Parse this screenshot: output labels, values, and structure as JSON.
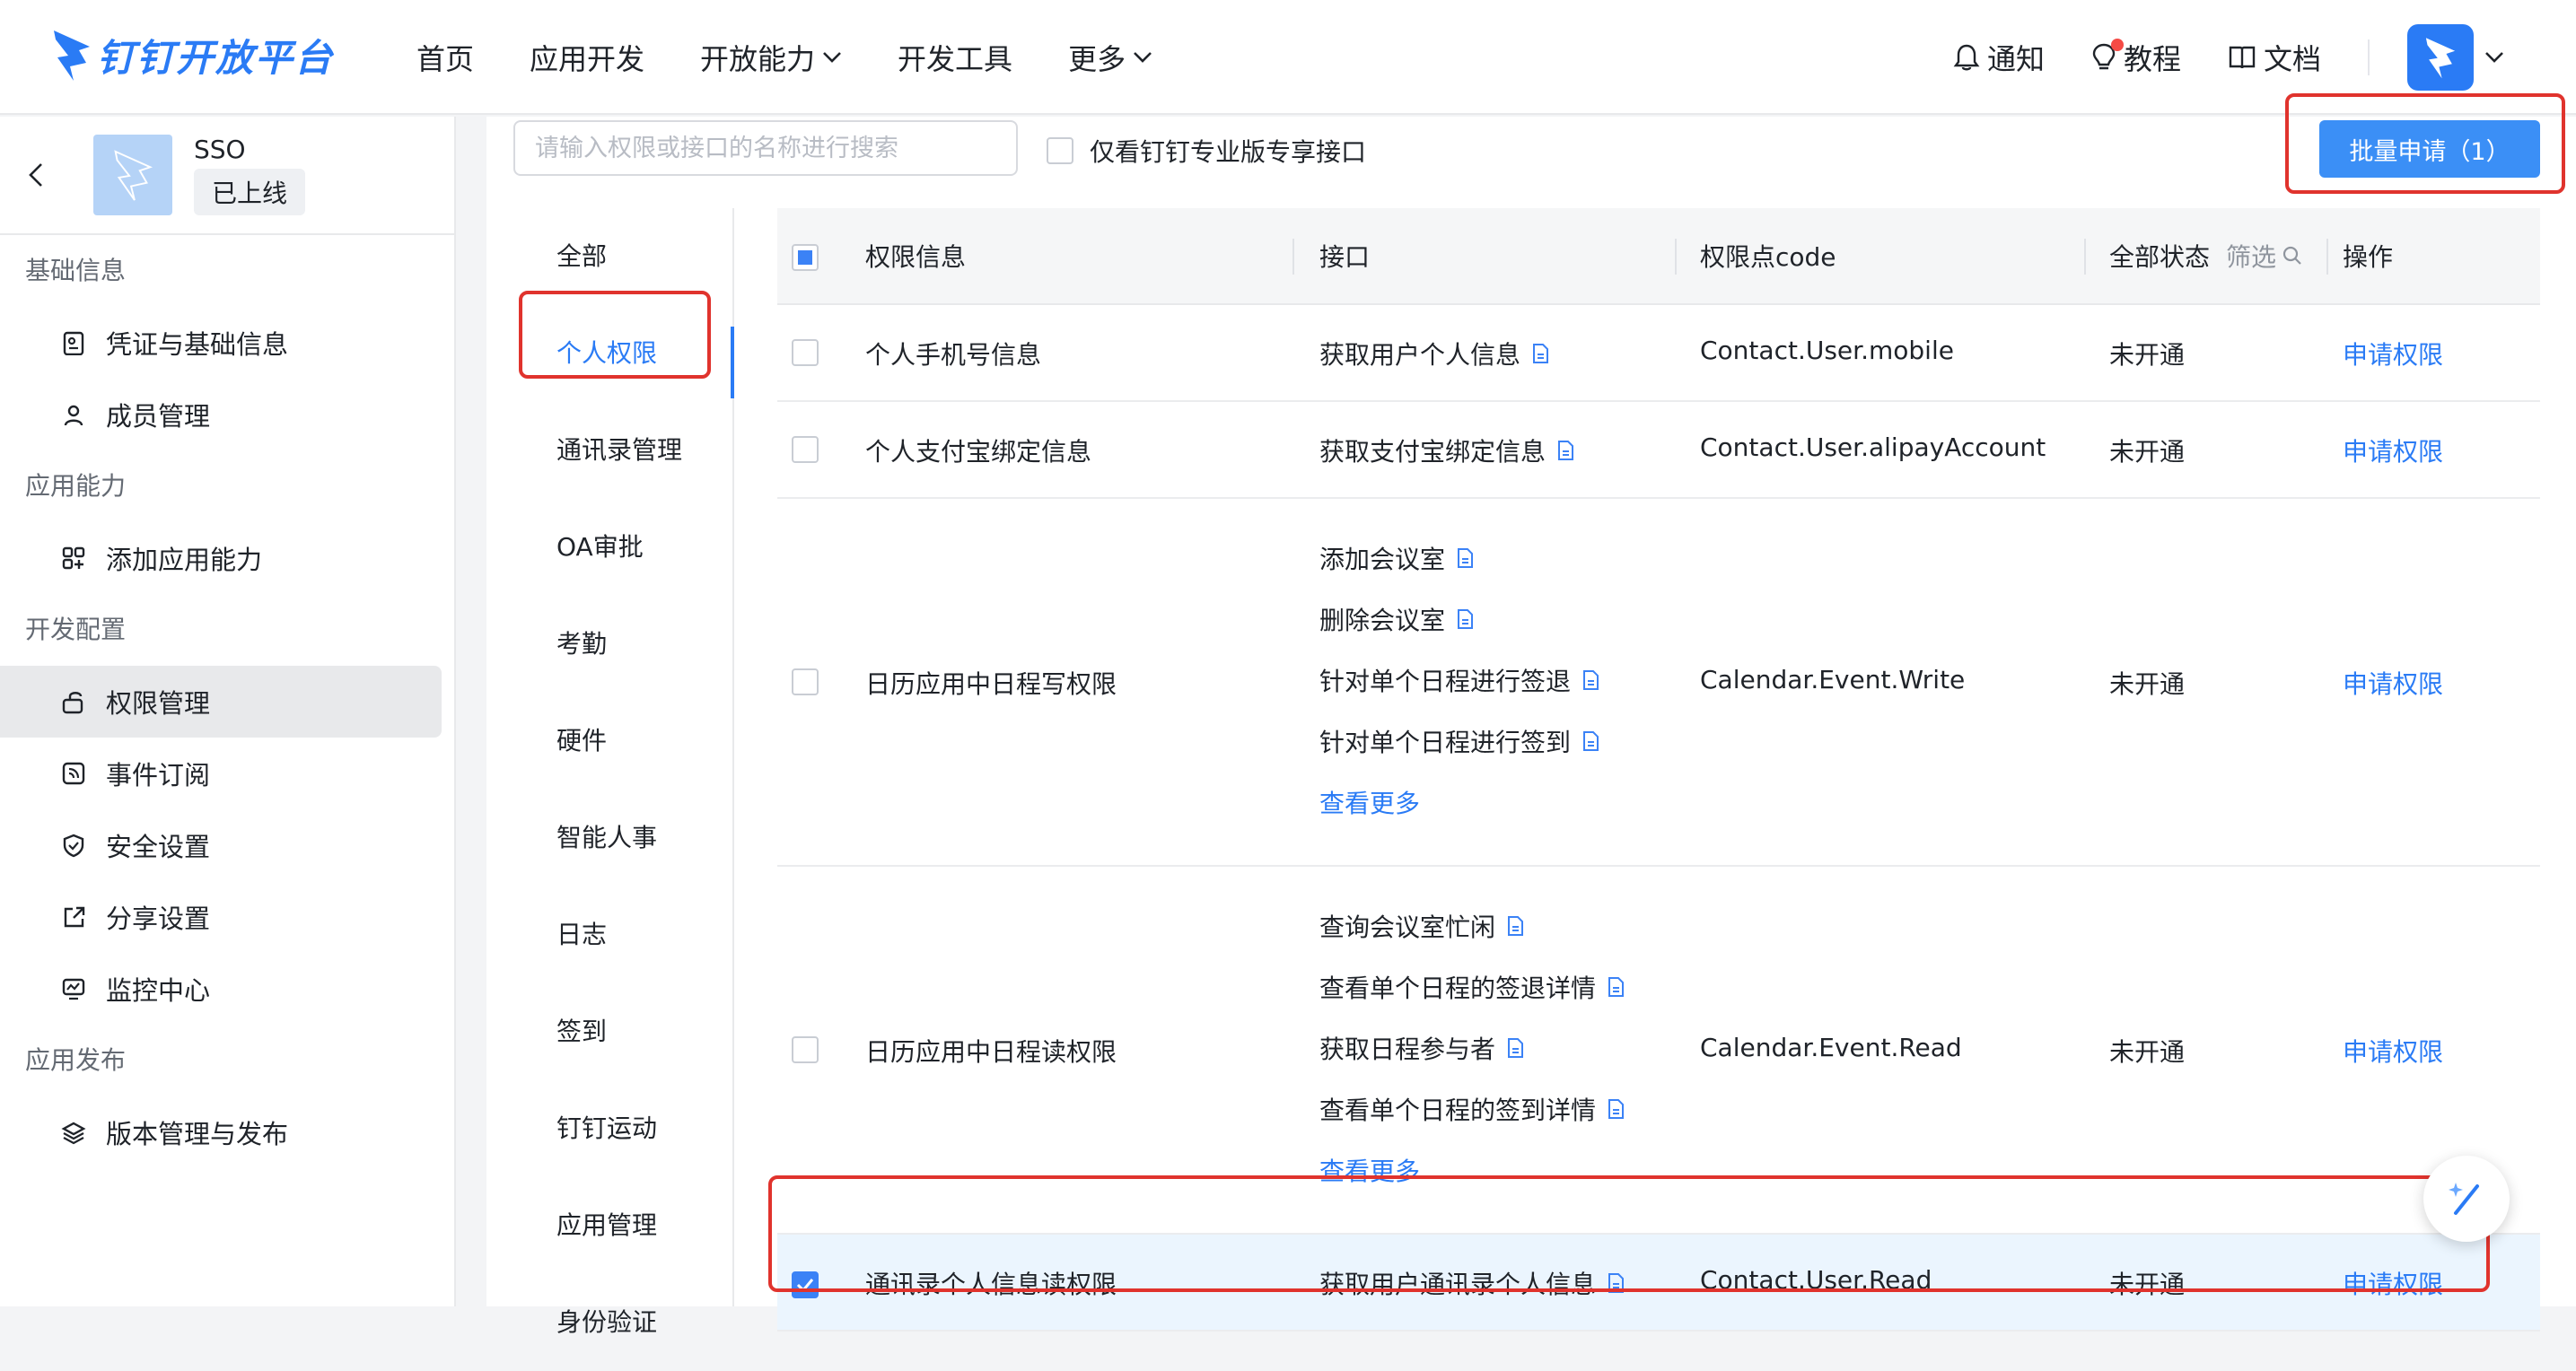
{
  "header": {
    "logo_text": "钉钉开放平台",
    "nav": [
      {
        "label": "首页",
        "dropdown": false
      },
      {
        "label": "应用开发",
        "dropdown": false
      },
      {
        "label": "开放能力",
        "dropdown": true
      },
      {
        "label": "开发工具",
        "dropdown": false
      },
      {
        "label": "更多",
        "dropdown": true
      }
    ],
    "notify_label": "通知",
    "tutorial_label": "教程",
    "docs_label": "文档"
  },
  "sidebar": {
    "app_name": "SSO",
    "app_status": "已上线",
    "groups": [
      {
        "title": "基础信息",
        "items": [
          {
            "label": "凭证与基础信息",
            "icon": "credential-icon"
          },
          {
            "label": "成员管理",
            "icon": "user-icon"
          }
        ]
      },
      {
        "title": "应用能力",
        "items": [
          {
            "label": "添加应用能力",
            "icon": "apps-add-icon"
          }
        ]
      },
      {
        "title": "开发配置",
        "items": [
          {
            "label": "权限管理",
            "icon": "lock-icon",
            "active": true
          },
          {
            "label": "事件订阅",
            "icon": "rss-icon"
          },
          {
            "label": "安全设置",
            "icon": "shield-icon"
          },
          {
            "label": "分享设置",
            "icon": "share-icon"
          },
          {
            "label": "监控中心",
            "icon": "monitor-icon"
          }
        ]
      },
      {
        "title": "应用发布",
        "items": [
          {
            "label": "版本管理与发布",
            "icon": "layers-icon"
          }
        ]
      }
    ]
  },
  "toolbar": {
    "search_placeholder": "请输入权限或接口的名称进行搜索",
    "pro_only_label": "仅看钉钉专业版专享接口",
    "batch_label": "批量申请（1）"
  },
  "categories": [
    "全部",
    "个人权限",
    "通讯录管理",
    "OA审批",
    "考勤",
    "硬件",
    "智能人事",
    "日志",
    "签到",
    "钉钉运动",
    "应用管理",
    "身份验证"
  ],
  "active_category": 1,
  "table": {
    "headers": {
      "info": "权限信息",
      "api": "接口",
      "code": "权限点code",
      "status": "全部状态",
      "filter": "筛选",
      "action": "操作"
    },
    "rows": [
      {
        "name": "个人手机号信息",
        "apis": [
          "获取用户个人信息"
        ],
        "more": "",
        "code": "Contact.User.mobile",
        "status": "未开通",
        "action": "申请权限",
        "checked": false
      },
      {
        "name": "个人支付宝绑定信息",
        "apis": [
          "获取支付宝绑定信息"
        ],
        "more": "",
        "code": "Contact.User.alipayAccount",
        "status": "未开通",
        "action": "申请权限",
        "checked": false
      },
      {
        "name": "日历应用中日程写权限",
        "apis": [
          "添加会议室",
          "删除会议室",
          "针对单个日程进行签退",
          "针对单个日程进行签到"
        ],
        "more": "查看更多",
        "code": "Calendar.Event.Write",
        "status": "未开通",
        "action": "申请权限",
        "checked": false
      },
      {
        "name": "日历应用中日程读权限",
        "apis": [
          "查询会议室忙闲",
          "查看单个日程的签退详情",
          "获取日程参与者",
          "查看单个日程的签到详情"
        ],
        "more": "查看更多",
        "code": "Calendar.Event.Read",
        "status": "未开通",
        "action": "申请权限",
        "checked": false
      },
      {
        "name": "通讯录个人信息读权限",
        "apis": [
          "获取用户通讯录个人信息"
        ],
        "more": "",
        "code": "Contact.User.Read",
        "status": "未开通",
        "action": "申请权限",
        "checked": true
      }
    ]
  },
  "colors": {
    "accent": "#2a7bf5",
    "highlight": "#e0332d",
    "selected_row": "#ebf5fe"
  }
}
